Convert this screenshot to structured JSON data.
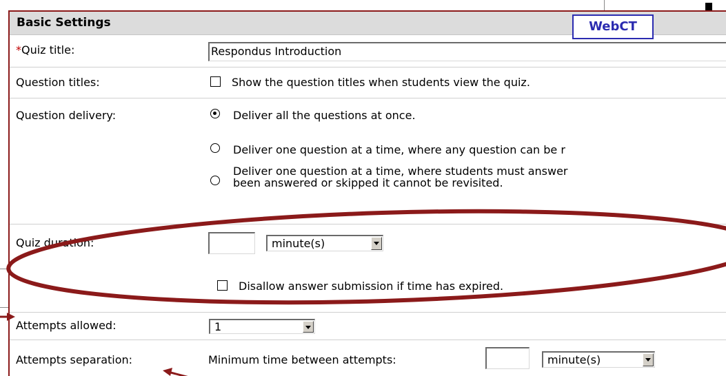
{
  "header": {
    "title": "Basic Settings"
  },
  "badge": {
    "label": "WebCT"
  },
  "quiz_title": {
    "required_marker": "*",
    "label": "Quiz title:",
    "value": "Respondus Introduction"
  },
  "question_titles": {
    "label": "Question titles:",
    "option": "Show the question titles when students view the quiz.",
    "checked": false
  },
  "question_delivery": {
    "label": "Question delivery:",
    "options": [
      {
        "text": "Deliver all the questions at once.",
        "selected": true
      },
      {
        "text": "Deliver one question at a time, where any question can be r",
        "selected": false
      },
      {
        "line1": "Deliver one question at a time, where students must answer",
        "line2": "been answered or skipped it cannot be revisited.",
        "selected": false
      }
    ]
  },
  "quiz_duration": {
    "label": "Quiz duration:",
    "value": "",
    "unit": "minute(s)",
    "disallow_option": "Disallow answer submission if time has expired.",
    "disallow_checked": false
  },
  "attempts_allowed": {
    "label": "Attempts allowed:",
    "value": "1"
  },
  "attempts_separation": {
    "label": "Attempts separation:",
    "prompt": "Minimum time between attempts:",
    "value": "",
    "unit": "minute(s)"
  },
  "colors": {
    "annotation": "#8b1a1a",
    "badge": "#2b2bb0",
    "header_bg": "#dcdcdc",
    "required": "#c00000"
  }
}
